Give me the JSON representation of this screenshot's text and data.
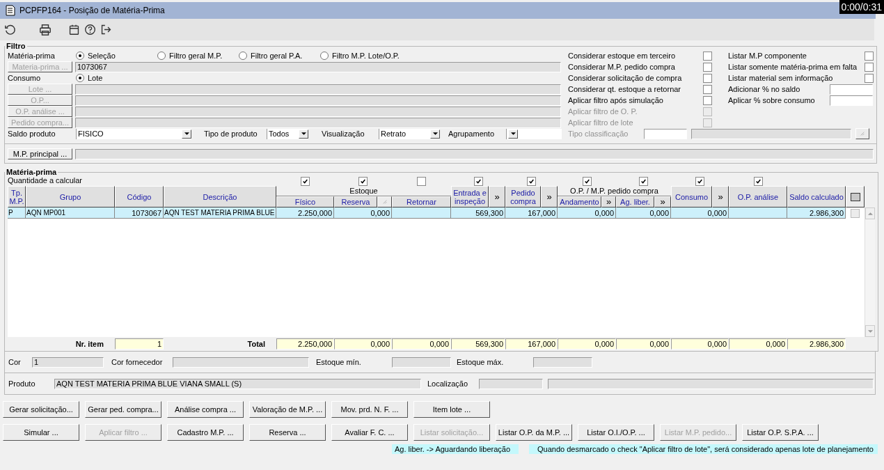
{
  "window": {
    "title": "PCPFP164 - Posição de Matéria-Prima"
  },
  "video_timer": "0:00/0:31",
  "filter": {
    "title": "Filtro",
    "rows": [
      {
        "kind": "radio",
        "label": "Matéria-prima",
        "options": [
          {
            "label": "Seleção",
            "selected": true
          },
          {
            "label": "Filtro geral M.P.",
            "selected": false
          },
          {
            "label": "Filtro geral P.A.",
            "selected": false
          },
          {
            "label": "Filtro M.P. Lote/O.P.",
            "selected": false
          }
        ]
      },
      {
        "kind": "lookup",
        "button": "Materia-prima ...",
        "disabled": true,
        "value": "1073067"
      },
      {
        "kind": "radio",
        "label": "Consumo",
        "options": [
          {
            "label": "Lote",
            "selected": true
          }
        ]
      },
      {
        "kind": "lookup",
        "button": "Lote ...",
        "disabled": true
      },
      {
        "kind": "lookup",
        "button": "O.P...",
        "disabled": true
      },
      {
        "kind": "lookup",
        "button": "O.P. análise ...",
        "disabled": true
      },
      {
        "kind": "lookup",
        "button": "Pedido compra...",
        "disabled": true
      }
    ],
    "selects": [
      {
        "label": "Saldo produto",
        "value": "FISICO"
      },
      {
        "label": "Tipo de produto",
        "value": "Todos"
      },
      {
        "label": "Visualização",
        "value": "Retrato"
      },
      {
        "label": "Agrupamento"
      }
    ],
    "options": [
      {
        "label": "Considerar estoque em terceiro",
        "checked": false,
        "disabled": false
      },
      {
        "label": "Considerar M.P. pedido compra",
        "checked": false,
        "disabled": false
      },
      {
        "label": "Considerar solicitação de compra",
        "checked": false,
        "disabled": false
      },
      {
        "label": "Considerar qt. estoque a retornar",
        "checked": false,
        "disabled": false
      },
      {
        "label": "Aplicar filtro após simulação",
        "checked": false,
        "disabled": false
      },
      {
        "label": "Aplicar filtro de O. P.",
        "checked": false,
        "disabled": true
      },
      {
        "label": "Aplicar filtro de lote",
        "checked": false,
        "disabled": true
      }
    ],
    "options_b": [
      {
        "kind": "check",
        "label": "Listar M.P componente",
        "checked": false
      },
      {
        "kind": "check",
        "label": "Listar somente matéria-prima em falta",
        "checked": false
      },
      {
        "kind": "check",
        "label": "Listar material sem informação",
        "checked": false
      },
      {
        "kind": "field",
        "label": "Adicionar % no saldo"
      },
      {
        "kind": "field",
        "label": "Aplicar % sobre consumo"
      }
    ],
    "classification": {
      "label": "Tipo classificação",
      "disabled": true
    },
    "principal": {
      "button": "M.P. principal ..."
    }
  },
  "grid": {
    "title": "Matéria-prima",
    "quantity_label": "Quantidade a calcular",
    "quantity_checks": [
      {
        "checked": true
      },
      {
        "checked": true
      },
      {
        "checked": false
      },
      {
        "checked": true
      },
      {
        "checked": true
      },
      {
        "checked": true
      },
      {
        "checked": true
      },
      {
        "checked": true
      },
      {
        "checked": true
      }
    ],
    "headers": [
      {
        "kind": "column",
        "label": "Tp. M.P."
      },
      {
        "kind": "column",
        "label": "Grupo"
      },
      {
        "kind": "column",
        "label": "Código"
      },
      {
        "kind": "column",
        "label": "Descrição"
      },
      {
        "kind": "group",
        "label": "Estoque"
      },
      {
        "kind": "column",
        "label": "Físico"
      },
      {
        "kind": "column",
        "label": "Reserva"
      },
      {
        "kind": "column",
        "label": "Retornar"
      },
      {
        "kind": "column",
        "label": "Entrada e inspeção"
      },
      {
        "kind": "expand",
        "label": "»"
      },
      {
        "kind": "column",
        "label": "Pedido compra"
      },
      {
        "kind": "expand",
        "label": "»"
      },
      {
        "kind": "group",
        "label": "O.P. / M.P. pedido compra"
      },
      {
        "kind": "column",
        "label": "Andamento"
      },
      {
        "kind": "expand",
        "label": "»"
      },
      {
        "kind": "column",
        "label": "Ag. liber."
      },
      {
        "kind": "expand",
        "label": "»"
      },
      {
        "kind": "column",
        "label": "Consumo"
      },
      {
        "kind": "expand",
        "label": "»"
      },
      {
        "kind": "column",
        "label": "O.P. análise"
      },
      {
        "kind": "column",
        "label": "Saldo calculado"
      }
    ],
    "rows": [
      {
        "selected": true,
        "checked": false,
        "cells": [
          "P",
          "AQN MP001",
          "1073067",
          "AQN TEST MATERIA PRIMA BLUE",
          "2.250,000",
          "0,000",
          null,
          "569,300",
          "167,000",
          "0,000",
          "0,000",
          "0,000",
          null,
          "2.986,300"
        ]
      }
    ],
    "count_label": "Nr. item",
    "count": "1",
    "total_label": "Total",
    "totals": [
      "2.250,000",
      "0,000",
      "0,000",
      "569,300",
      "167,000",
      "0,000",
      "0,000",
      "0,000",
      "0,000",
      "2.986,300"
    ]
  },
  "details": {
    "cor_label": "Cor",
    "cor": "1",
    "supplier_label": "Cor fornecedor",
    "min_label": "Estoque mín.",
    "max_label": "Estoque máx.",
    "product_label": "Produto",
    "product": "AQN TEST MATERIA PRIMA BLUE VIANA SMALL (S)",
    "location_label": "Localização"
  },
  "buttons": [
    [
      {
        "label": "Gerar solicitação...",
        "disabled": false
      },
      {
        "label": "Gerar ped. compra...",
        "disabled": false
      },
      {
        "label": "Análise compra ...",
        "disabled": false
      },
      {
        "label": "Valoração de M.P. ...",
        "disabled": false
      },
      {
        "label": "Mov. prd. N. F. ...",
        "disabled": false
      },
      {
        "label": "Item lote ...",
        "disabled": false
      }
    ],
    [
      {
        "label": "Simular ...",
        "disabled": false
      },
      {
        "label": "Aplicar filtro ...",
        "disabled": true
      },
      {
        "label": "Cadastro M.P. ...",
        "disabled": false
      },
      {
        "label": "Reserva ...",
        "disabled": false
      },
      {
        "label": "Avaliar F. C. ...",
        "disabled": false
      },
      {
        "label": "Listar solicitação...",
        "disabled": true
      },
      {
        "label": "Listar O.P. da M.P. ...",
        "disabled": false
      },
      {
        "label": "Listar O.I./O.P. ...",
        "disabled": false
      },
      {
        "label": "Listar M.P. pedido...",
        "disabled": true
      },
      {
        "label": "Listar O.P. S.P.A. ...",
        "disabled": false
      }
    ]
  ],
  "notes": [
    "Ag. liber. -> Aguardando liberação",
    "Quando desmarcado o check \"Aplicar filtro de lote\", será considerado apenas lote de planejamento"
  ]
}
